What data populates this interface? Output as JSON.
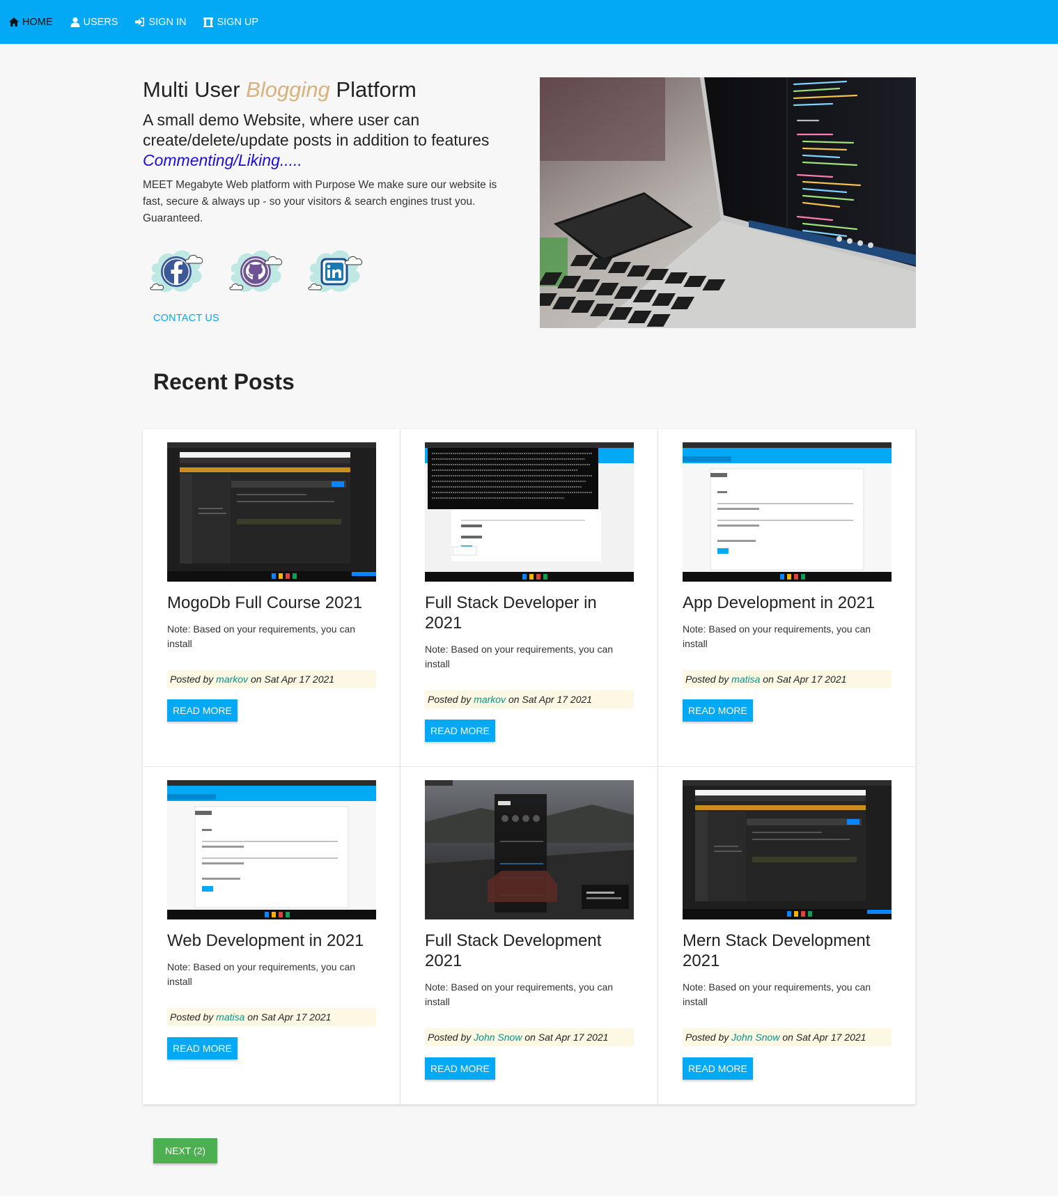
{
  "nav": {
    "items": [
      {
        "label": "HOME",
        "icon": "home-icon"
      },
      {
        "label": "USERS",
        "icon": "user-icon"
      },
      {
        "label": "SIGN IN",
        "icon": "sign-in-icon"
      },
      {
        "label": "SIGN UP",
        "icon": "university-icon"
      }
    ]
  },
  "hero": {
    "title_pre": "Multi User",
    "title_accent": "Blogging",
    "title_post": "Platform",
    "subtitle": "A small demo Website, where user can create/delete/update posts in addition to features",
    "subtitle_accent": "Commenting/Liking.....",
    "description": "MEET Megabyte Web platform with Purpose We make sure our website is fast, secure & always up - so your visitors & search engines trust you. Guaranteed.",
    "contact": "CONTACT US"
  },
  "social": [
    "facebook-icon",
    "github-icon",
    "linkedin-icon"
  ],
  "recent_title": "Recent Posts",
  "posts": [
    {
      "title": "MogoDb Full Course 2021",
      "note": "Note: Based on your requirements, you can install",
      "posted_by": "Posted by",
      "author": "markov",
      "date": "on Sat Apr 17 2021",
      "button": "READ MORE"
    },
    {
      "title": "Full Stack Developer in 2021",
      "note": "Note: Based on your requirements, you can install",
      "posted_by": "Posted by",
      "author": "markov",
      "date": "on Sat Apr 17 2021",
      "button": "READ MORE"
    },
    {
      "title": "App Development in 2021",
      "note": "Note: Based on your requirements, you can install",
      "posted_by": "Posted by",
      "author": "matisa",
      "date": "on Sat Apr 17 2021",
      "button": "READ MORE"
    },
    {
      "title": "Web Development in 2021",
      "note": "Note: Based on your requirements, you can install",
      "posted_by": "Posted by",
      "author": "matisa",
      "date": "on Sat Apr 17 2021",
      "button": "READ MORE"
    },
    {
      "title": "Full Stack Development 2021",
      "note": "Note: Based on your requirements, you can install",
      "posted_by": "Posted by",
      "author": "John Snow",
      "date": "on Sat Apr 17 2021",
      "button": "READ MORE"
    },
    {
      "title": "Mern Stack Development 2021",
      "note": "Note: Based on your requirements, you can install",
      "posted_by": "Posted by",
      "author": "John Snow",
      "date": "on Sat Apr 17 2021",
      "button": "READ MORE"
    }
  ],
  "next_button": "NEXT (2)",
  "colors": {
    "navbar": "#03a9f4",
    "accent_gold": "#d9b17c",
    "link_blue": "#1a0dd6",
    "author_teal": "#009688",
    "next_green": "#4caf50"
  }
}
